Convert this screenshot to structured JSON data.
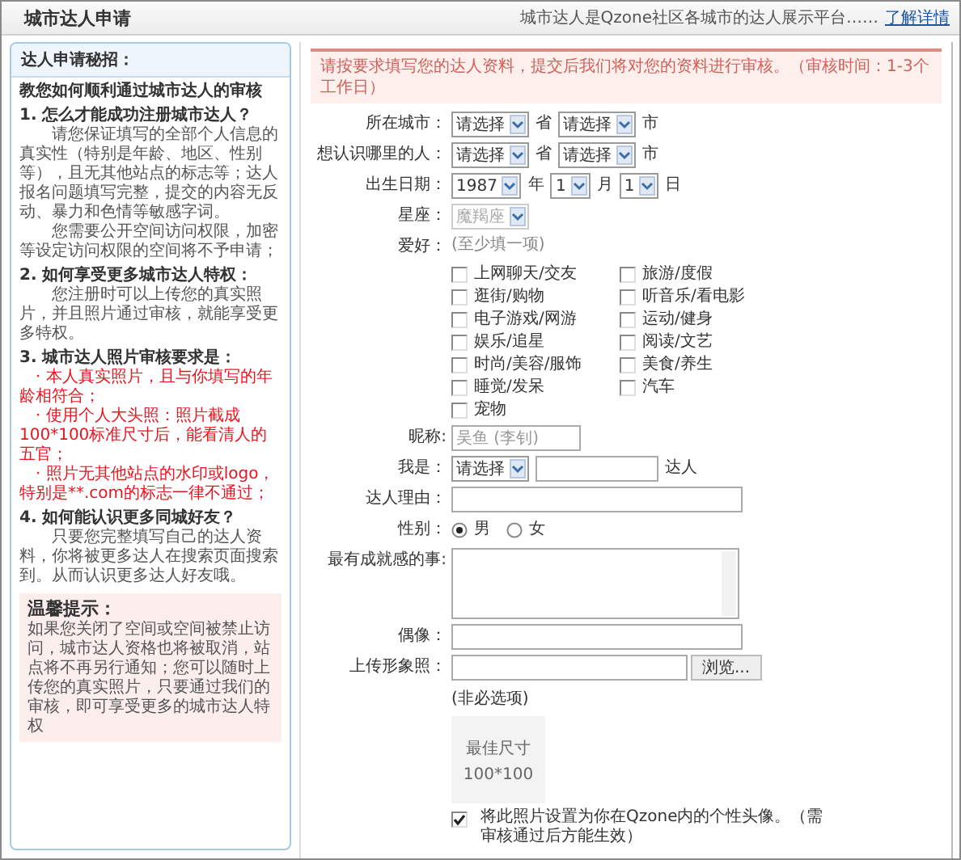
{
  "header": {
    "title": "城市达人申请",
    "tagline": "城市达人是Qzone社区各城市的达人展示平台……",
    "link": "了解详情"
  },
  "sidebar": {
    "title": "达人申请秘招：",
    "heading": "教您如何顺利通过城市达人的审核",
    "sections": [
      {
        "title": "1. 怎么才能成功注册城市达人？",
        "paragraphs": [
          {
            "kind": "normal",
            "text": "请您保证填写的全部个人信息的真实性（特别是年龄、地区、性别等），且无其他站点的标志等；达人报名问题填写完整，提交的内容无反动、暴力和色情等敏感字词。"
          },
          {
            "kind": "normal",
            "text": "您需要公开空间访问权限，加密等设定访问权限的空间将不予申请；"
          }
        ]
      },
      {
        "title": "2. 如何享受更多城市达人特权：",
        "paragraphs": [
          {
            "kind": "normal",
            "text": "您注册时可以上传您的真实照片，并且照片通过审核，就能享受更多特权。"
          }
        ]
      },
      {
        "title": "3. 城市达人照片审核要求是：",
        "paragraphs": [
          {
            "kind": "warning",
            "text": "· 本人真实照片，且与你填写的年龄相符合；"
          },
          {
            "kind": "warning",
            "text": "· 使用个人大头照：照片截成100*100标准尺寸后，能看清人的五官；"
          },
          {
            "kind": "warning",
            "text": "· 照片无其他站点的水印或logo，特别是**.com的标志一律不通过；"
          }
        ]
      },
      {
        "title": "4. 如何能认识更多同城好友？",
        "paragraphs": [
          {
            "kind": "normal",
            "text": "只要您完整填写自己的达人资料，你将被更多达人在搜索页面搜索到。从而认识更多达人好友哦。"
          }
        ]
      }
    ],
    "tip": {
      "title": "温馨提示：",
      "text": "如果您关闭了空间或空间被禁止访问，城市达人资格也将被取消，站点将不再另行通知；您可以随时上传您的真实照片，只要通过我们的审核，即可享受更多的城市达人特权"
    }
  },
  "notice": "请按要求填写您的达人资料，提交后我们将对您的资料进行审核。（审核时间：1-3个工作日）",
  "rows": [
    {
      "kind": "selects",
      "label": "所在城市：",
      "fields": [
        {
          "value": "请选择",
          "unit": "省",
          "disabled": false
        },
        {
          "value": "请选择",
          "unit": "市",
          "disabled": false
        }
      ]
    },
    {
      "kind": "selects",
      "label": "想认识哪里的人：",
      "fields": [
        {
          "value": "请选择",
          "unit": "省",
          "disabled": false
        },
        {
          "value": "请选择",
          "unit": "市",
          "disabled": false
        }
      ]
    },
    {
      "kind": "selects",
      "label": "出生日期：",
      "fields": [
        {
          "value": "1987",
          "unit": "年",
          "disabled": false
        },
        {
          "value": "1",
          "unit": "月",
          "disabled": false
        },
        {
          "value": "1",
          "unit": "日",
          "disabled": false
        }
      ]
    },
    {
      "kind": "selects",
      "label": "星座：",
      "fields": [
        {
          "value": "魔羯座",
          "disabled": true
        }
      ]
    },
    {
      "kind": "checkboxes",
      "label": "爱好：",
      "hint": "(至少填一项)",
      "options": [
        {
          "label": "上网聊天/交友",
          "checked": false
        },
        {
          "label": "旅游/度假",
          "checked": false
        },
        {
          "label": "逛街/购物",
          "checked": false
        },
        {
          "label": "听音乐/看电影",
          "checked": false
        },
        {
          "label": "电子游戏/网游",
          "checked": false
        },
        {
          "label": "运动/健身",
          "checked": false
        },
        {
          "label": "娱乐/追星",
          "checked": false
        },
        {
          "label": "阅读/文艺",
          "checked": false
        },
        {
          "label": "时尚/美容/服饰",
          "checked": false
        },
        {
          "label": "美食/养生",
          "checked": false
        },
        {
          "label": "睡觉/发呆",
          "checked": false
        },
        {
          "label": "汽车",
          "checked": false
        },
        {
          "label": "宠物",
          "checked": false
        }
      ]
    },
    {
      "kind": "text",
      "label": "昵称:",
      "placeholder": "吴鱼 (李钊)",
      "short": true
    },
    {
      "kind": "select_text",
      "label": "我是：",
      "value": "请选择",
      "suffix": "达人"
    },
    {
      "kind": "text",
      "label": "达人理由：",
      "short": false
    },
    {
      "kind": "radio",
      "label": "性别：",
      "options": [
        {
          "label": "男",
          "selected": true
        },
        {
          "label": "女",
          "selected": false
        }
      ]
    },
    {
      "kind": "textarea",
      "label": "最有成就感的事:"
    },
    {
      "kind": "text",
      "label": "偶像：",
      "short": false
    },
    {
      "kind": "file",
      "label": "上传形象照：",
      "button": "浏览...",
      "note": "(非必选项)",
      "preview": [
        "最佳尺寸",
        "100*100"
      ]
    }
  ],
  "avatar_option": {
    "checked": true,
    "text": "将此照片设置为你在Qzone内的个性头像。（需审核通过后方能生效）"
  }
}
